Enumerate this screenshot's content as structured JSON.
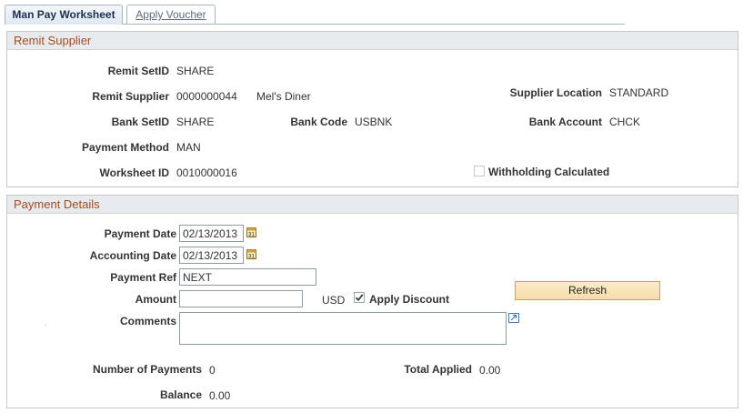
{
  "tabs": {
    "active": "Man Pay Worksheet",
    "inactive": "Apply Voucher"
  },
  "remit_supplier": {
    "title": "Remit Supplier",
    "remit_setid_label": "Remit SetID",
    "remit_setid_value": "SHARE",
    "remit_supplier_label": "Remit Supplier",
    "remit_supplier_id": "0000000044",
    "remit_supplier_name": "Mel's Diner",
    "supplier_location_label": "Supplier Location",
    "supplier_location_value": "STANDARD",
    "bank_setid_label": "Bank SetID",
    "bank_setid_value": "SHARE",
    "bank_code_label": "Bank Code",
    "bank_code_value": "USBNK",
    "bank_account_label": "Bank Account",
    "bank_account_value": "CHCK",
    "payment_method_label": "Payment Method",
    "payment_method_value": "MAN",
    "worksheet_id_label": "Worksheet ID",
    "worksheet_id_value": "0010000016",
    "withholding_label": "Withholding Calculated",
    "withholding_checked": false
  },
  "payment_details": {
    "title": "Payment Details",
    "payment_date_label": "Payment Date",
    "payment_date_value": "02/13/2013",
    "accounting_date_label": "Accounting Date",
    "accounting_date_value": "02/13/2013",
    "payment_ref_label": "Payment Ref",
    "payment_ref_value": "NEXT",
    "amount_label": "Amount",
    "amount_value": "",
    "currency": "USD",
    "apply_discount_label": "Apply Discount",
    "apply_discount_checked": true,
    "refresh_label": "Refresh",
    "comments_label": "Comments",
    "comments_value": "",
    "number_of_payments_label": "Number of Payments",
    "number_of_payments_value": "0",
    "total_applied_label": "Total Applied",
    "total_applied_value": "0.00",
    "balance_label": "Balance",
    "balance_value": "0.00"
  },
  "colors": {
    "section_title": "#a34a20",
    "button_bg": "#f6dcaa",
    "border": "#c7c7c7"
  }
}
